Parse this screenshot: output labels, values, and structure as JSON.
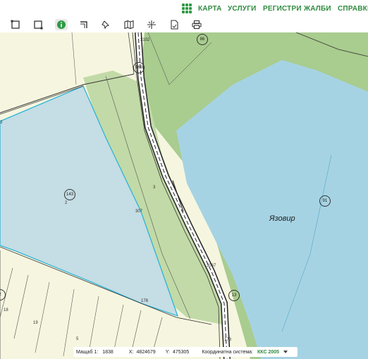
{
  "nav": {
    "items": [
      "КАРТА",
      "УСЛУГИ",
      "РЕГИСТРИ",
      "ЖАЛБИ",
      "СПРАВКИ"
    ]
  },
  "toolbar": {
    "tools": [
      "select-rectangle-icon",
      "select-rectangle-alt-icon",
      "info-icon",
      "corner-tool-icon",
      "pin-icon",
      "map-book-icon",
      "measure-icon",
      "document-icon",
      "print-icon"
    ],
    "active_tool": "info-icon"
  },
  "map": {
    "water_label": "Язовир",
    "parcel_ids": [
      "86",
      "166",
      "143",
      "91",
      "13",
      "2"
    ],
    "small_labels": [
      "3102",
      "3",
      "2",
      "307",
      "3",
      "3067",
      "173",
      "178",
      "18",
      "19",
      "5",
      "173"
    ],
    "colors": {
      "water": "#a6d3e3",
      "forest": "#a9cc8f",
      "field": "#f6f6e0",
      "selected_parcel": "#c5dde4",
      "road": "#ffffff"
    }
  },
  "status": {
    "scale_label": "Мащаб 1:",
    "scale_value": "1838",
    "x_label": "X:",
    "x_value": "4824679",
    "y_label": "Y:",
    "y_value": "475305",
    "crs_label": "Координатна система:",
    "crs_value": "ККС 2005"
  }
}
